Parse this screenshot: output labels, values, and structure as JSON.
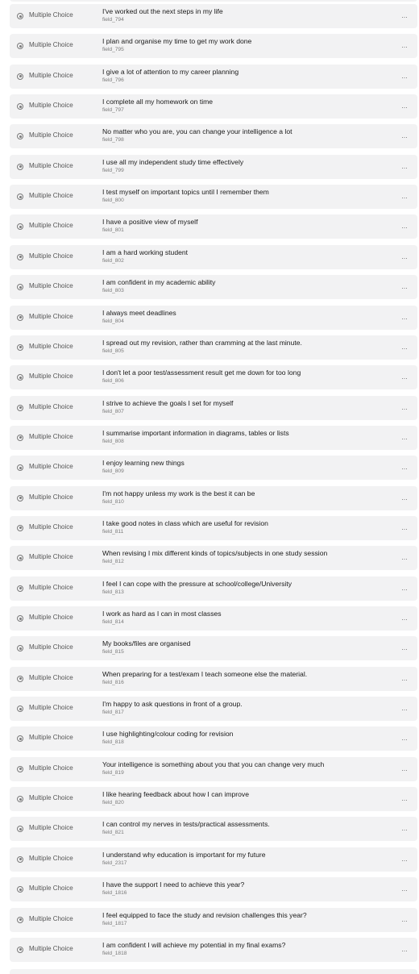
{
  "rows": [
    {
      "type": "Multiple Choice",
      "question": "I've worked out the next steps in my life",
      "field": "field_794",
      "more": "..."
    },
    {
      "type": "Multiple Choice",
      "question": "I plan and organise my time to get my work done",
      "field": "field_795",
      "more": "..."
    },
    {
      "type": "Multiple Choice",
      "question": "I give a lot of attention to my career planning",
      "field": "field_796",
      "more": "..."
    },
    {
      "type": "Multiple Choice",
      "question": "I complete all my homework on time",
      "field": "field_797",
      "more": "..."
    },
    {
      "type": "Multiple Choice",
      "question": "No matter who you are, you can change your intelligence a lot",
      "field": "field_798",
      "more": "..."
    },
    {
      "type": "Multiple Choice",
      "question": "I use all my independent study time effectively",
      "field": "field_799",
      "more": "..."
    },
    {
      "type": "Multiple Choice",
      "question": "I test myself on important topics until I remember them",
      "field": "field_800",
      "more": "..."
    },
    {
      "type": "Multiple Choice",
      "question": "I have a positive view of myself",
      "field": "field_801",
      "more": "..."
    },
    {
      "type": "Multiple Choice",
      "question": "I am a hard working student",
      "field": "field_802",
      "more": "..."
    },
    {
      "type": "Multiple Choice",
      "question": "I am confident in my academic ability",
      "field": "field_803",
      "more": "..."
    },
    {
      "type": "Multiple Choice",
      "question": "I always meet deadlines",
      "field": "field_804",
      "more": "..."
    },
    {
      "type": "Multiple Choice",
      "question": "I spread out my revision, rather than cramming at the last minute.",
      "field": "field_805",
      "more": "..."
    },
    {
      "type": "Multiple Choice",
      "question": "I don't let a poor test/assessment result get me down for too long",
      "field": "field_806",
      "more": "..."
    },
    {
      "type": "Multiple Choice",
      "question": "I strive to achieve the goals I set for myself",
      "field": "field_807",
      "more": "..."
    },
    {
      "type": "Multiple Choice",
      "question": "I summarise important information in diagrams, tables or lists",
      "field": "field_808",
      "more": "..."
    },
    {
      "type": "Multiple Choice",
      "question": "I enjoy learning new things",
      "field": "field_809",
      "more": "..."
    },
    {
      "type": "Multiple Choice",
      "question": "I'm not happy unless my work is the best it can be",
      "field": "field_810",
      "more": "..."
    },
    {
      "type": "Multiple Choice",
      "question": "I take good notes in class which are useful for revision",
      "field": "field_811",
      "more": "..."
    },
    {
      "type": "Multiple Choice",
      "question": "When revising I mix different kinds of topics/subjects in one study session",
      "field": "field_812",
      "more": "..."
    },
    {
      "type": "Multiple Choice",
      "question": "I feel I can cope with the pressure at school/college/University",
      "field": "field_813",
      "more": "..."
    },
    {
      "type": "Multiple Choice",
      "question": "I work as hard as I can in most classes",
      "field": "field_814",
      "more": "..."
    },
    {
      "type": "Multiple Choice",
      "question": "My books/files are organised",
      "field": "field_815",
      "more": "..."
    },
    {
      "type": "Multiple Choice",
      "question": "When preparing for a test/exam I teach someone else the material.",
      "field": "field_816",
      "more": "..."
    },
    {
      "type": "Multiple Choice",
      "question": "I'm happy to ask questions in front of a group.",
      "field": "field_817",
      "more": "..."
    },
    {
      "type": "Multiple Choice",
      "question": "I use highlighting/colour coding for revision",
      "field": "field_818",
      "more": "..."
    },
    {
      "type": "Multiple Choice",
      "question": "Your intelligence is something about you that you can change very much",
      "field": "field_819",
      "more": "..."
    },
    {
      "type": "Multiple Choice",
      "question": "I like hearing feedback about how I can improve",
      "field": "field_820",
      "more": "..."
    },
    {
      "type": "Multiple Choice",
      "question": "I can control my nerves in tests/practical assessments.",
      "field": "field_821",
      "more": "..."
    },
    {
      "type": "Multiple Choice",
      "question": "I understand why education is important for my future",
      "field": "field_2317",
      "more": "..."
    },
    {
      "type": "Multiple Choice",
      "question": "I have the support I need to achieve this year?",
      "field": "field_1816",
      "more": "..."
    },
    {
      "type": "Multiple Choice",
      "question": "I feel equipped to face the study and revision challenges this year?",
      "field": "field_1817",
      "more": "..."
    },
    {
      "type": "Multiple Choice",
      "question": "I am confident I will achieve my potential in my final exams?",
      "field": "field_1818",
      "more": "..."
    }
  ],
  "colors": {
    "row_bg": "#f2f2f3",
    "text": "#1a1a1a",
    "muted": "#7a7a7a"
  },
  "icons": {
    "type_icon": "radio-button-icon",
    "menu_icon": "more-horizontal-icon"
  }
}
